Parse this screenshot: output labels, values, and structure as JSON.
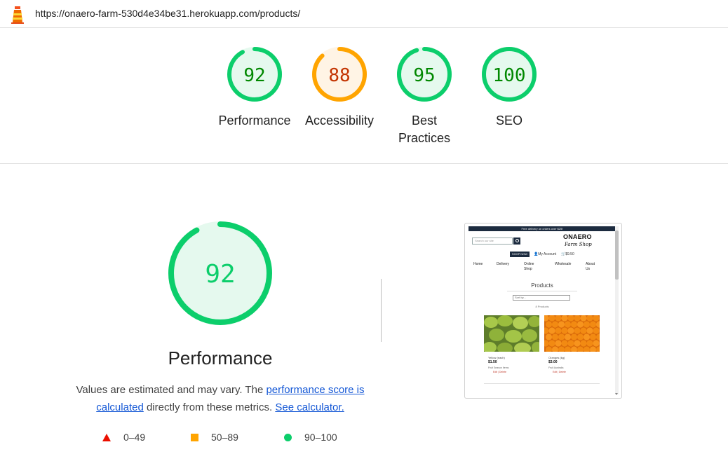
{
  "browser": {
    "url": "https://onaero-farm-530d4e34be31.herokuapp.com/products/"
  },
  "categories": [
    {
      "label": "Performance",
      "score": "92",
      "value": 92,
      "status": "pass"
    },
    {
      "label": "Accessibility",
      "score": "88",
      "value": 88,
      "status": "average"
    },
    {
      "label": "Best\nPractices",
      "score": "95",
      "value": 95,
      "status": "pass"
    },
    {
      "label": "SEO",
      "score": "100",
      "value": 100,
      "status": "pass"
    }
  ],
  "colors": {
    "pass": "#0cce6b",
    "pass_text": "#008800",
    "pass_bg": "#e5f9ee",
    "average": "#ffa400",
    "average_text": "#c33300",
    "average_bg": "#fff4e5",
    "fail": "#eb0f00",
    "link": "#1558d6"
  },
  "performance": {
    "score": "92",
    "value": 92,
    "title": "Performance",
    "desc_prefix": "Values are estimated and may vary. The ",
    "desc_link1": "performance score is calculated",
    "desc_middle": " directly from these metrics. ",
    "desc_link2": "See calculator."
  },
  "legend": [
    {
      "shape": "triangle",
      "range": "0–49"
    },
    {
      "shape": "square",
      "range": "50–89"
    },
    {
      "shape": "circle",
      "range": "90–100"
    }
  ],
  "thumbnail": {
    "banner": "Free delivery on orders over $25!",
    "brand": "ONAERO",
    "brand_sub": "Farm Shop",
    "search_placeholder": "Search our site",
    "shop_now": "SHOP NOW",
    "account": "My Account",
    "cart": "$9.50",
    "nav": [
      "Home",
      "Delivery",
      "Online Shop",
      "Wholesale",
      "About Us"
    ],
    "heading": "Products",
    "sort": "Sort by...",
    "count": "8 Products",
    "products": [
      {
        "name": "Yellow (each)",
        "price": "$1.50",
        "meta": "Fruit  Season Items",
        "actions": "Edit | Delete"
      },
      {
        "name": "Oranges (kg)",
        "price": "$3.00",
        "meta": "Fruit  Australia",
        "actions": "Edit | Delete"
      }
    ]
  }
}
